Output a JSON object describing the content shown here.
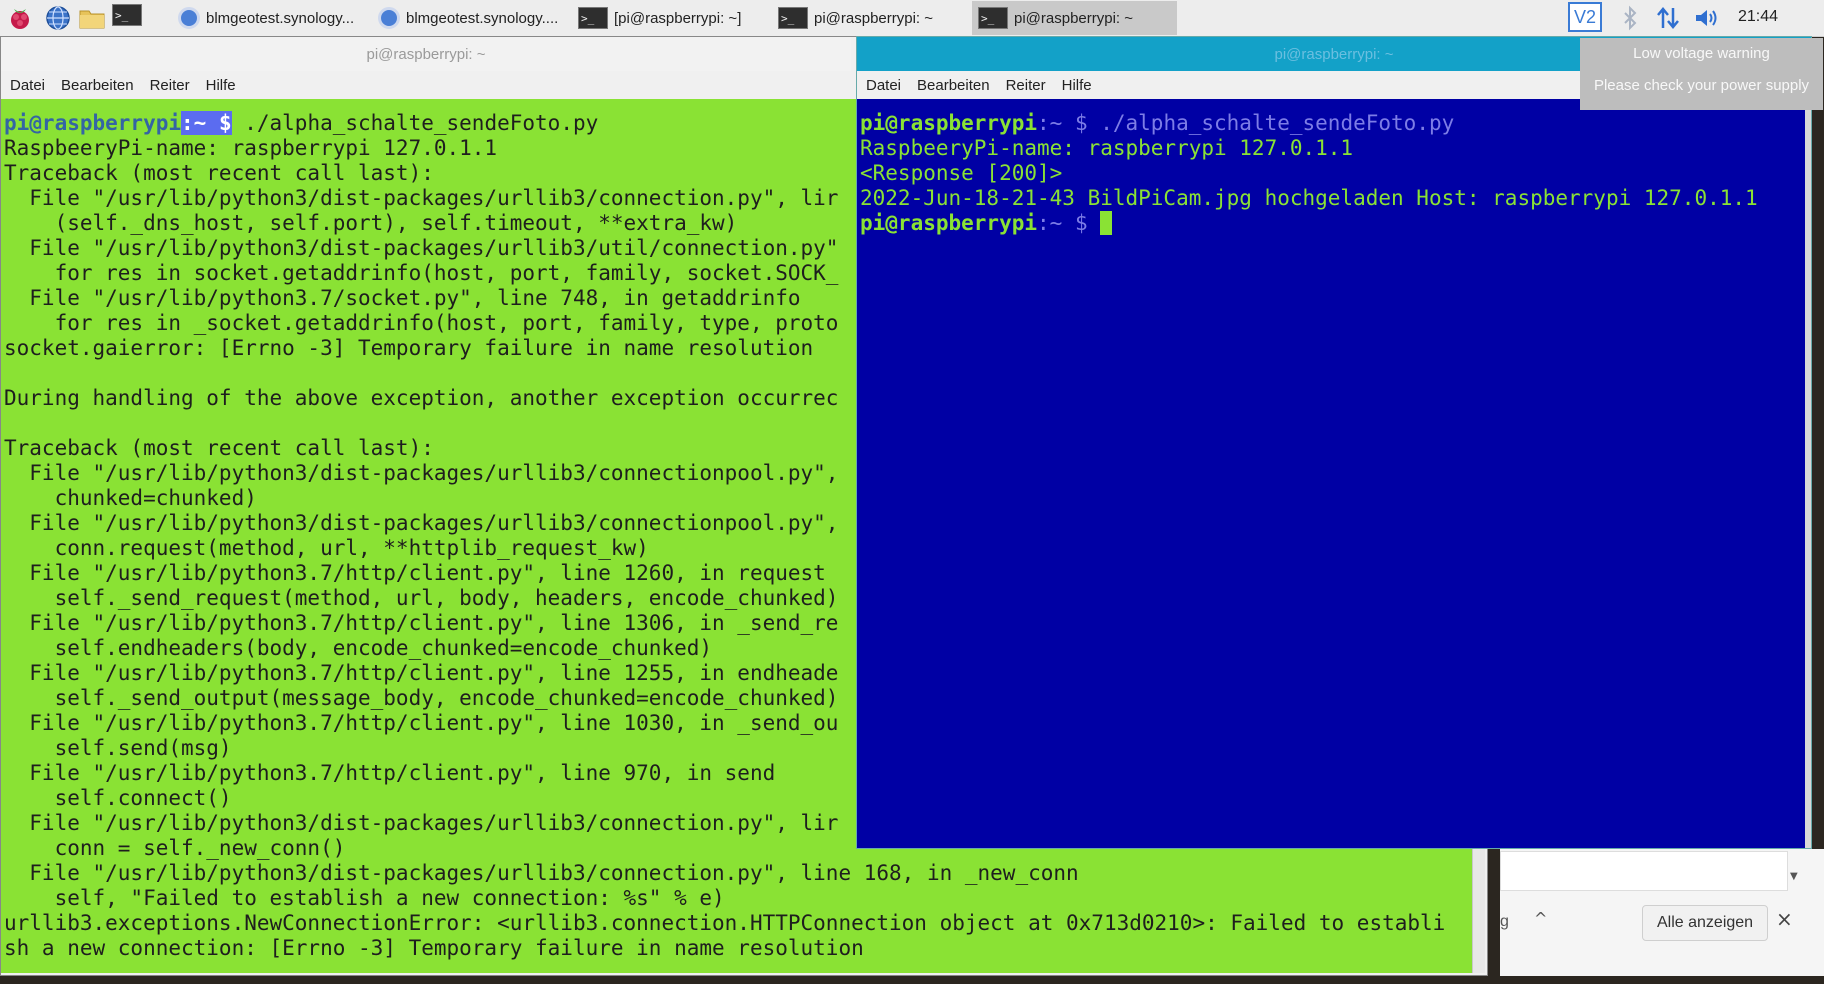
{
  "taskbar": {
    "tasks": [
      {
        "label": "blmgeotest.synology...",
        "kind": "browser"
      },
      {
        "label": "blmgeotest.synology....",
        "kind": "browser"
      },
      {
        "label": "[pi@raspberrypi: ~]",
        "kind": "terminal"
      },
      {
        "label": "pi@raspberrypi: ~",
        "kind": "terminal"
      },
      {
        "label": "pi@raspberrypi: ~",
        "kind": "terminal",
        "active": true
      }
    ],
    "terminal_glyph": ">_",
    "tray": {
      "vnc_label": "V2",
      "clock": "21:44"
    }
  },
  "notification": {
    "title": "Low voltage warning",
    "message": "Please check your power supply"
  },
  "left_window": {
    "title": "pi@raspberrypi: ~",
    "menu": [
      "Datei",
      "Bearbeiten",
      "Reiter",
      "Hilfe"
    ],
    "prompt": {
      "user": "pi@raspberrypi",
      "path": ":~ $",
      "command": " ./alpha_schalte_sendeFoto.py"
    },
    "output": [
      "RaspbeeryPi-name: raspberrypi 127.0.1.1",
      "Traceback (most recent call last):",
      "  File \"/usr/lib/python3/dist-packages/urllib3/connection.py\", lir",
      "    (self._dns_host, self.port), self.timeout, **extra_kw)",
      "  File \"/usr/lib/python3/dist-packages/urllib3/util/connection.py\"",
      "    for res in socket.getaddrinfo(host, port, family, socket.SOCK_",
      "  File \"/usr/lib/python3.7/socket.py\", line 748, in getaddrinfo",
      "    for res in _socket.getaddrinfo(host, port, family, type, proto",
      "socket.gaierror: [Errno -3] Temporary failure in name resolution",
      "",
      "During handling of the above exception, another exception occurrec",
      "",
      "Traceback (most recent call last):",
      "  File \"/usr/lib/python3/dist-packages/urllib3/connectionpool.py\",",
      "    chunked=chunked)",
      "  File \"/usr/lib/python3/dist-packages/urllib3/connectionpool.py\",",
      "    conn.request(method, url, **httplib_request_kw)",
      "  File \"/usr/lib/python3.7/http/client.py\", line 1260, in request",
      "    self._send_request(method, url, body, headers, encode_chunked)",
      "  File \"/usr/lib/python3.7/http/client.py\", line 1306, in _send_re",
      "    self.endheaders(body, encode_chunked=encode_chunked)",
      "  File \"/usr/lib/python3.7/http/client.py\", line 1255, in endheade",
      "    self._send_output(message_body, encode_chunked=encode_chunked)",
      "  File \"/usr/lib/python3.7/http/client.py\", line 1030, in _send_ou",
      "    self.send(msg)",
      "  File \"/usr/lib/python3.7/http/client.py\", line 970, in send",
      "    self.connect()",
      "  File \"/usr/lib/python3/dist-packages/urllib3/connection.py\", lir",
      "    conn = self._new_conn()",
      "  File \"/usr/lib/python3/dist-packages/urllib3/connection.py\", line 168, in _new_conn",
      "    self, \"Failed to establish a new connection: %s\" % e)",
      "urllib3.exceptions.NewConnectionError: <urllib3.connection.HTTPConnection object at 0x713d0210>: Failed to establi",
      "sh a new connection: [Errno -3] Temporary failure in name resolution"
    ]
  },
  "right_window": {
    "title": "pi@raspberrypi: ~",
    "menu": [
      "Datei",
      "Bearbeiten",
      "Reiter",
      "Hilfe"
    ],
    "prompt": {
      "user": "pi@raspberrypi",
      "path": ":~ $",
      "command": " ./alpha_schalte_sendeFoto.py"
    },
    "output": [
      "RaspbeeryPi-name: raspberrypi 127.0.1.1",
      "<Response [200]>",
      "2022-Jun-18-21-43 BildPiCam.jpg hochgeladen Host: raspberrypi 127.0.1.1"
    ],
    "prompt2": {
      "user": "pi@raspberrypi",
      "path": ":~ $ "
    }
  },
  "download_bar": {
    "partial_text": "g",
    "caret": "^",
    "show_all_label": "Alle anzeigen",
    "close": "×"
  }
}
